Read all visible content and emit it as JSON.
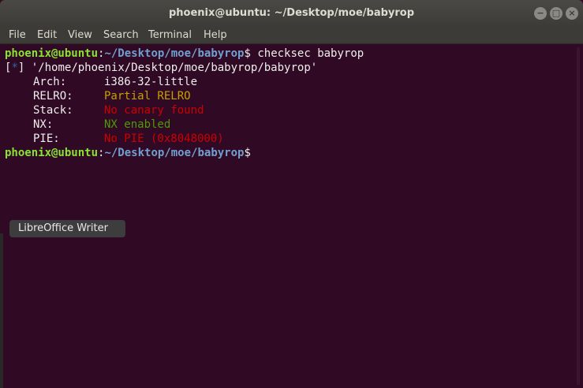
{
  "window": {
    "title": "phoenix@ubuntu: ~/Desktop/moe/babyrop",
    "controls": {
      "minimize": "−",
      "maximize": "□",
      "close": "×"
    }
  },
  "menu": [
    "File",
    "Edit",
    "View",
    "Search",
    "Terminal",
    "Help"
  ],
  "terminal": {
    "prompt_user": "phoenix@ubuntu",
    "prompt_colon": ":",
    "prompt_path": "~/Desktop/moe/babyrop",
    "prompt_symbol": "$",
    "command": " checksec babyrop",
    "info_marker": "*",
    "info_path": " '/home/phoenix/Desktop/moe/babyrop/babyrop'",
    "checks": [
      {
        "label": "Arch:",
        "value": "i386-32-little",
        "color": "#eeeeec"
      },
      {
        "label": "RELRO:",
        "value": "Partial RELRO",
        "color": "#c4a000"
      },
      {
        "label": "Stack:",
        "value": "No canary found",
        "color": "#cc0000"
      },
      {
        "label": "NX:",
        "value": "NX enabled",
        "color": "#4e9a06"
      },
      {
        "label": "PIE:",
        "value": "No PIE (0x8048000)",
        "color": "#cc0000"
      }
    ]
  },
  "tooltip": {
    "text": "LibreOffice Writer"
  },
  "colors": {
    "background": "#300a24",
    "prompt_user": "#8ae234",
    "prompt_path": "#729fcf"
  }
}
